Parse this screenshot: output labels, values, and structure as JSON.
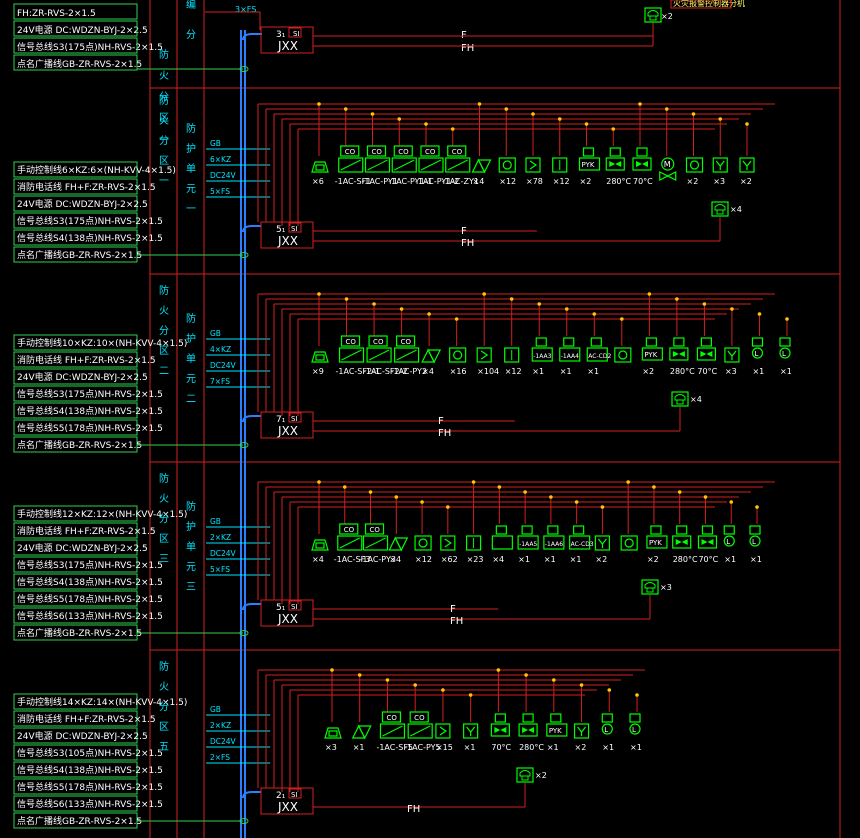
{
  "colors": {
    "background": "#000000",
    "frame": "#d42020",
    "trunk": "#2a7fff",
    "bus": "#30d050",
    "device": "#00ff00",
    "label": "#ffffff",
    "zone_text": "#00e5ff",
    "tap_dot": "#ffc800"
  },
  "top": {
    "cables": [
      "FH:ZR-RVS-2×1.5",
      "24V电源 DC:WDZN-BYJ-2×2.5",
      "信号总线S3(175点)NH-RVS-2×1.5",
      "点名广播线GB-ZR-RVS-2×1.5"
    ],
    "box_num": "3₁",
    "box_si": "SI",
    "box_label": "JXX",
    "line_f": "F",
    "line_fh": "FH",
    "zone_col1": [
      "防",
      "火",
      "分",
      "区",
      "一"
    ],
    "zone_col2_top": [
      "编",
      "分"
    ],
    "bus_label": "3×FS",
    "top_note": "火灾报警控制器分机",
    "phone_count": "×2"
  },
  "sections": [
    {
      "cables": [
        "手动控制线6×KZ:6×(NH-KVV-4×1.5)",
        "消防电话线 FH+F:ZR-RVS-2×1.5",
        "24V电源 DC:WDZN-BYJ-2×2.5",
        "信号总线S3(175点)NH-RVS-2×1.5",
        "信号总线S4(138点)NH-RVS-2×1.5",
        "点名广播线GB-ZR-RVS-2×1.5"
      ],
      "zone_col1": [
        "防",
        "火",
        "分",
        "区",
        "一"
      ],
      "zone_col2": [
        "防",
        "护",
        "单",
        "元",
        "一"
      ],
      "bus_labels": [
        "GB",
        "6×KZ",
        "DC24V",
        "5×FS"
      ],
      "box_num": "5₁",
      "box_si": "SI",
      "box_label": "JXX",
      "line_f": "F",
      "line_fh": "FH",
      "devices": [
        {
          "icon": "speaker",
          "code": "",
          "label": "×6"
        },
        {
          "icon": "module",
          "code": "-1AC-SF1",
          "label": ""
        },
        {
          "icon": "module",
          "code": "-1AC-PY1",
          "label": ""
        },
        {
          "icon": "module",
          "code": "-1AC-PY1-1",
          "label": ""
        },
        {
          "icon": "module",
          "code": "-1AC-PY1-2",
          "label": ""
        },
        {
          "icon": "module",
          "code": "-1AC-ZY1",
          "label": ""
        },
        {
          "icon": "bell",
          "code": "",
          "label": "×4"
        },
        {
          "icon": "smoke",
          "code": "",
          "label": "×12"
        },
        {
          "icon": "sd",
          "code": "",
          "label": "×78"
        },
        {
          "icon": "heat",
          "code": "",
          "label": "×12"
        },
        {
          "icon": "pyk",
          "code": "",
          "label": "×2"
        },
        {
          "icon": "valve",
          "code": "",
          "label": "280°C"
        },
        {
          "icon": "valve",
          "code": "",
          "label": "70°C"
        },
        {
          "icon": "m",
          "code": "",
          "label": ""
        },
        {
          "icon": "smoke",
          "code": "",
          "label": "×2"
        },
        {
          "icon": "y",
          "code": "",
          "label": "×3"
        },
        {
          "icon": "y",
          "code": "",
          "label": "×2"
        }
      ],
      "phone_count": "×4"
    },
    {
      "cables": [
        "手动控制线10×KZ:10×(NH-KVV-4×1.5)",
        "消防电话线 FH+F:ZR-RVS-2×1.5",
        "24V电源 DC:WDZN-BYJ-2×2.5",
        "信号总线S3(175点)NH-RVS-2×1.5",
        "信号总线S4(138点)NH-RVS-2×1.5",
        "信号总线S5(178点)NH-RVS-2×1.5",
        "点名广播线GB-ZR-RVS-2×1.5"
      ],
      "zone_col1": [
        "防",
        "火",
        "分",
        "区",
        "二"
      ],
      "zone_col2": [
        "防",
        "护",
        "单",
        "元",
        "二"
      ],
      "bus_labels": [
        "GB",
        "4×KZ",
        "DC24V",
        "7×FS"
      ],
      "box_num": "7₁",
      "box_si": "SI",
      "box_label": "JXX",
      "line_f": "F",
      "line_fh": "FH",
      "devices": [
        {
          "icon": "speaker",
          "code": "",
          "label": "×9"
        },
        {
          "icon": "module",
          "code": "-1AC-SF2-1",
          "label": ""
        },
        {
          "icon": "module",
          "code": "-1AC-SF2-2",
          "label": ""
        },
        {
          "icon": "module",
          "code": "-1AC-PY2",
          "label": ""
        },
        {
          "icon": "bell",
          "code": "",
          "label": "×4"
        },
        {
          "icon": "smoke",
          "code": "",
          "label": "×16"
        },
        {
          "icon": "sd",
          "code": "",
          "label": "×104"
        },
        {
          "icon": "heat",
          "code": "",
          "label": "×12"
        },
        {
          "icon": "mod2",
          "code": "-1AA3",
          "label": "×1"
        },
        {
          "icon": "mod2",
          "code": "-1AA4",
          "label": "×1"
        },
        {
          "icon": "mod2",
          "code": "AC-CD2",
          "label": "×1"
        },
        {
          "icon": "smoke",
          "code": "",
          "label": ""
        },
        {
          "icon": "pyk",
          "code": "",
          "label": "×2"
        },
        {
          "icon": "valve",
          "code": "",
          "label": "280°C"
        },
        {
          "icon": "valve",
          "code": "",
          "label": "70°C"
        },
        {
          "icon": "y",
          "code": "",
          "label": "×3"
        },
        {
          "icon": "l",
          "code": "",
          "label": "×1"
        },
        {
          "icon": "l",
          "code": "",
          "label": "×1"
        }
      ],
      "phone_count": "×4"
    },
    {
      "cables": [
        "手动控制线12×KZ:12×(NH-KVV-4×1.5)",
        "消防电话线 FH+F:ZR-RVS-2×1.5",
        "24V电源 DC:WDZN-BYJ-2×2.5",
        "信号总线S3(175点)NH-RVS-2×1.5",
        "信号总线S4(138点)NH-RVS-2×1.5",
        "信号总线S5(178点)NH-RVS-2×1.5",
        "信号总线S6(133点)NH-RVS-2×1.5",
        "点名广播线GB-ZR-RVS-2×1.5"
      ],
      "zone_col1": [
        "防",
        "火",
        "分",
        "区",
        "三"
      ],
      "zone_col2": [
        "防",
        "护",
        "单",
        "元",
        "三"
      ],
      "bus_labels": [
        "GB",
        "2×KZ",
        "DC24V",
        "5×FS"
      ],
      "box_num": "5₁",
      "box_si": "SI",
      "box_label": "JXX",
      "line_f": "F",
      "line_fh": "FH",
      "devices": [
        {
          "icon": "speaker",
          "code": "",
          "label": "×4"
        },
        {
          "icon": "module",
          "code": "-1AC-SF3",
          "label": ""
        },
        {
          "icon": "module",
          "code": "-1AC-PY3",
          "label": ""
        },
        {
          "icon": "bell",
          "code": "",
          "label": "×4"
        },
        {
          "icon": "smoke",
          "code": "",
          "label": "×12"
        },
        {
          "icon": "sd",
          "code": "",
          "label": "×62"
        },
        {
          "icon": "heat",
          "code": "",
          "label": "×23"
        },
        {
          "icon": "mod2",
          "code": "",
          "label": "×4"
        },
        {
          "icon": "mod2",
          "code": "-1AA5",
          "label": "×1"
        },
        {
          "icon": "mod2",
          "code": "-1AA6",
          "label": "×1"
        },
        {
          "icon": "mod2",
          "code": "AC-CD3",
          "label": "×1"
        },
        {
          "icon": "y",
          "code": "",
          "label": "×2"
        },
        {
          "icon": "smoke",
          "code": "",
          "label": ""
        },
        {
          "icon": "pyk",
          "code": "",
          "label": "×2"
        },
        {
          "icon": "valve",
          "code": "",
          "label": "280°C"
        },
        {
          "icon": "valve",
          "code": "",
          "label": "70°C"
        },
        {
          "icon": "l",
          "code": "",
          "label": "×1"
        },
        {
          "icon": "l",
          "code": "",
          "label": "×1"
        }
      ],
      "phone_count": "×3"
    },
    {
      "cables": [
        "手动控制线14×KZ:14×(NH-KVV-4×1.5)",
        "消防电话线 FH+F:ZR-RVS-2×1.5",
        "24V电源 DC:WDZN-BYJ-2×2.5",
        "信号总线S3(105点)NH-RVS-2×1.5",
        "信号总线S4(138点)NH-RVS-2×1.5",
        "信号总线S5(178点)NH-RVS-2×1.5",
        "信号总线S6(133点)NH-RVS-2×1.5",
        "点名广播线GB-ZR-RVS-2×1.5"
      ],
      "zone_col1": [
        "防",
        "火",
        "分",
        "区",
        "五"
      ],
      "zone_col2": [],
      "bus_labels": [
        "GB",
        "2×KZ",
        "DC24V",
        "2×FS"
      ],
      "box_num": "2₁",
      "box_si": "SI",
      "box_label": "JXX",
      "line_f": "",
      "line_fh": "FH",
      "devices": [
        {
          "icon": "speaker",
          "code": "",
          "label": "×3"
        },
        {
          "icon": "bell",
          "code": "",
          "label": "×1"
        },
        {
          "icon": "module",
          "code": "-1AC-SF5",
          "label": ""
        },
        {
          "icon": "module",
          "code": "-1AC-PY5",
          "label": ""
        },
        {
          "icon": "sd",
          "code": "",
          "label": "×15"
        },
        {
          "icon": "y",
          "code": "",
          "label": "×1"
        },
        {
          "icon": "valve",
          "code": "",
          "label": "70°C"
        },
        {
          "icon": "valve",
          "code": "",
          "label": "280°C"
        },
        {
          "icon": "pyk",
          "code": "",
          "label": "×1"
        },
        {
          "icon": "y",
          "code": "",
          "label": "×2"
        },
        {
          "icon": "l",
          "code": "",
          "label": "×1"
        },
        {
          "icon": "l",
          "code": "",
          "label": "×1"
        }
      ],
      "phone_count": "×2"
    }
  ]
}
